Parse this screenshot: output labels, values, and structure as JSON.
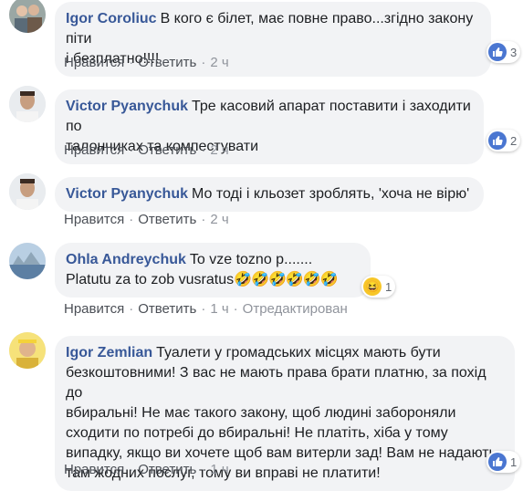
{
  "actions": {
    "like": "Нравится",
    "reply": "Ответить",
    "edited": "Отредактирован"
  },
  "colors": {
    "name": "#385898",
    "bubble": "#f2f3f5",
    "meta": "#90949c",
    "like_badge": "#4a76d1"
  },
  "comments": [
    {
      "author": "Igor Coroliuc",
      "lines": [
        "В кого є білет, має повне право...згідно закону піти",
        "і безплатно!!!!"
      ],
      "time": "2 ч",
      "reactions": {
        "icon": "like-icon",
        "count": "3"
      }
    },
    {
      "author": "Victor Pyanychuk",
      "lines": [
        "Тре касовий апарат поставити і заходити по",
        "талончиках та компестувати"
      ],
      "time": "2 ч",
      "reactions": {
        "icon": "like-icon",
        "count": "2"
      }
    },
    {
      "author": "Victor Pyanychuk",
      "lines": [
        "Мо тоді і кльозет зроблять, 'хоча не вірю'"
      ],
      "time": "2 ч"
    },
    {
      "author": "Ohla Andreychuk",
      "lines": [
        "To vze tozno p.......",
        "Platutu za to zob vusratus"
      ],
      "emoji": "🤣🤣🤣🤣🤣🤣",
      "time": "1 ч",
      "reactions": {
        "icon": "haha-icon",
        "count": "1"
      }
    },
    {
      "author": "Igor Zemlian",
      "lines": [
        "Туалети у громадських місцях мають бути",
        "безкоштовними! З вас не мають права брати платню, за похід до",
        "вбиральні! Не має такого закону, щоб людині забороняли",
        "сходити по потребі до вбиральні! Не платіть, хіба у тому",
        "випадку, якщо ви хочете щоб вам витерли зад! Вам не надають",
        "там жодних послуг, тому ви вправі не платити!"
      ],
      "time": "1 ч",
      "reactions": {
        "icon": "like-icon",
        "count": "1"
      }
    }
  ]
}
